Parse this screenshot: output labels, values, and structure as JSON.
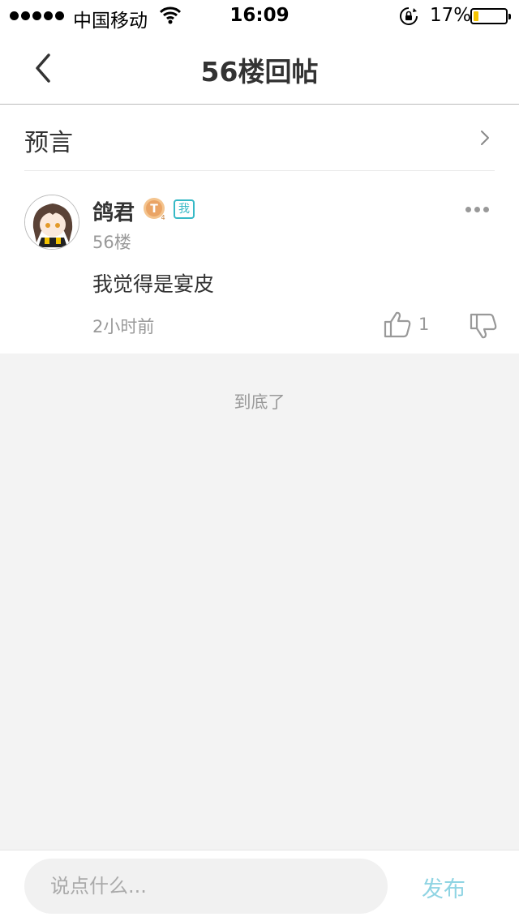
{
  "status_bar": {
    "carrier": "中国移动",
    "time": "16:09",
    "battery": "17%",
    "battery_level": 0.17,
    "battery_color": "#f5c400"
  },
  "nav": {
    "title": "56楼回帖",
    "back_icon": "chevron-left-icon"
  },
  "thread": {
    "title": "预言",
    "chevron_icon": "chevron-right-icon"
  },
  "post": {
    "username": "鸽君",
    "level_badge_icon": "level-badge-icon",
    "me_badge": "我",
    "floor": "56楼",
    "content": "我觉得是宴皮",
    "time": "2小时前",
    "likes": "1",
    "more_icon": "more-icon",
    "like_icon": "thumbs-up-icon",
    "dislike_icon": "thumbs-down-icon"
  },
  "end_message": "到底了",
  "bottom_bar": {
    "placeholder": "说点什么...",
    "publish_label": "发布",
    "accent_color": "#8fd4e3"
  }
}
